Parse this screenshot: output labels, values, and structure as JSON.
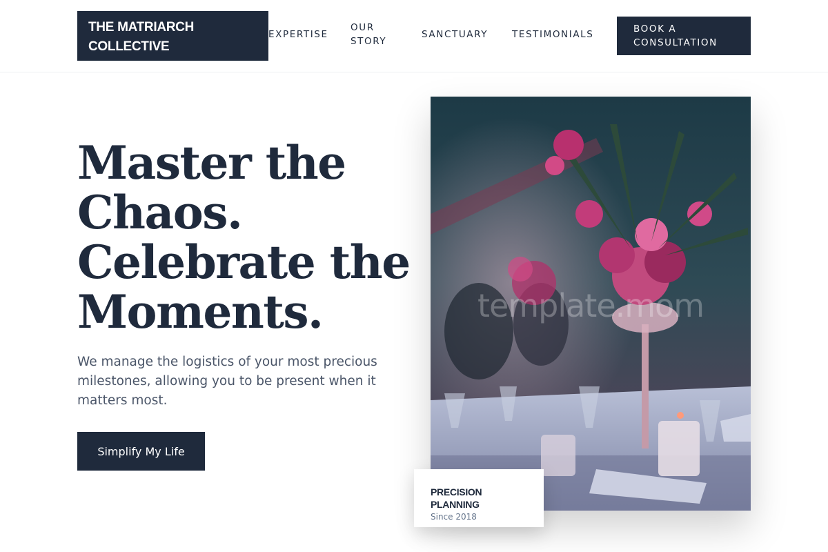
{
  "header": {
    "logo_line1": "THE MATRIARCH",
    "logo_line2": "COLLECTIVE",
    "nav": {
      "expertise": "EXPERTISE",
      "our_story": "OUR STORY",
      "sanctuary": "SANCTUARY",
      "testimonials": "TESTIMONIALS"
    },
    "cta": "BOOK A CONSULTATION"
  },
  "hero": {
    "headline_lines": [
      "Master the",
      "Chaos.",
      "Celebrate the",
      "Moments."
    ],
    "subtext": "We manage the logistics of your most precious milestones, allowing you to be present when it matters most.",
    "cta": "Simplify My Life",
    "image_watermark": "template.mom",
    "badge": {
      "title": "PRECISION PLANNING",
      "subtitle": "Since 2018"
    }
  },
  "colors": {
    "primary": "#1f2a3c",
    "text_muted": "#4a5568",
    "badge_sub": "#64748b",
    "background": "#ffffff"
  }
}
